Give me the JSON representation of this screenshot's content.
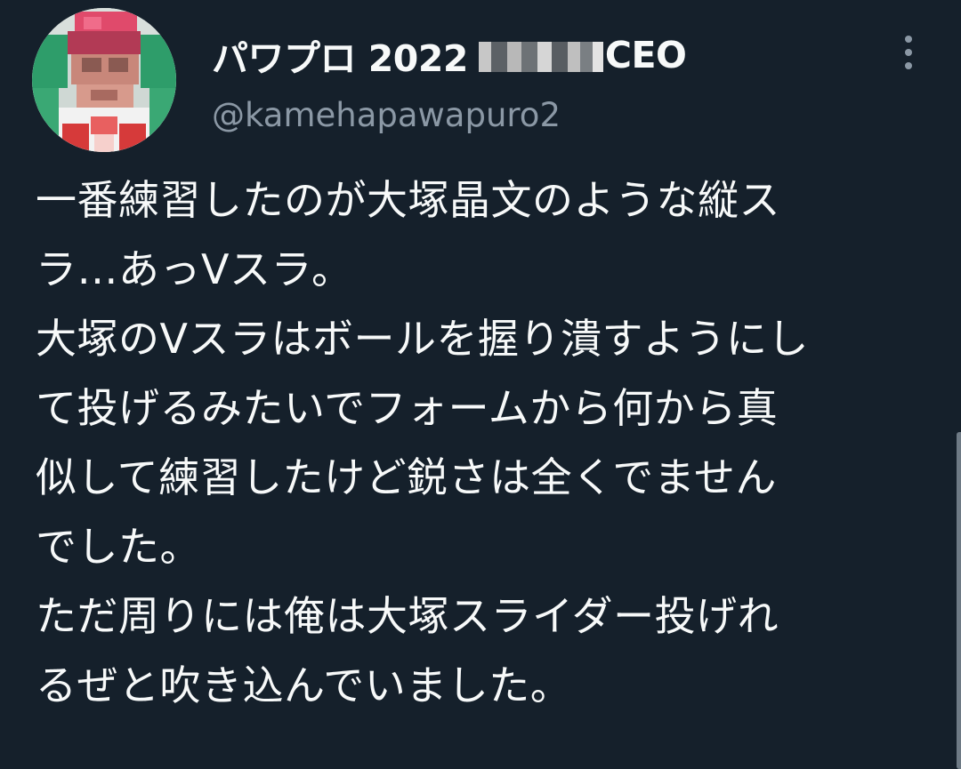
{
  "tweet": {
    "display_name_prefix": "パワプロ 2022 ",
    "display_name_suffix": "CEO",
    "handle": "@kamehapawapuro2",
    "text_lines": [
      "一番練習したのが大塚晶文のような縦ス",
      "ラ…あっVスラ。",
      "大塚のVスラはボールを握り潰すようにし",
      "て投げるみたいでフォームから何から真",
      "似して練習したけど鋭さは全くでません",
      "でした。",
      "ただ周りには俺は大塚スライダー投げれ",
      "るぜと吹き込んでいました。"
    ]
  },
  "icons": {
    "more": "more-vertical-icon"
  },
  "colors": {
    "background": "#15202b",
    "text_primary": "#f7f9f9",
    "text_secondary": "#8b98a5"
  }
}
